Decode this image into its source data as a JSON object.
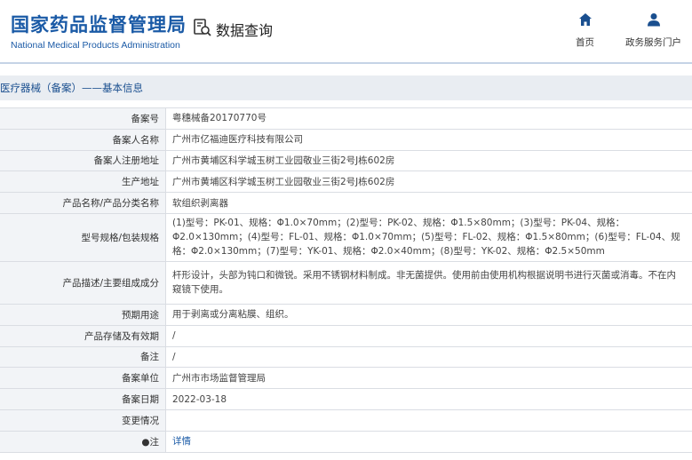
{
  "header": {
    "logo_cn": "国家药品监督管理局",
    "logo_en": "National Medical Products Administration",
    "query_label": "数据查询",
    "nav": {
      "home_label": "首页",
      "service_label": "政务服务门户"
    }
  },
  "section_title": "医疗器械（备案）——基本信息",
  "rows": [
    {
      "label": "备案号",
      "value": "粤穗械备20170770号"
    },
    {
      "label": "备案人名称",
      "value": "广州市亿福迪医疗科技有限公司"
    },
    {
      "label": "备案人注册地址",
      "value": "广州市黄埔区科学城玉树工业园敬业三街2号J栋602房"
    },
    {
      "label": "生产地址",
      "value": "广州市黄埔区科学城玉树工业园敬业三街2号J栋602房"
    },
    {
      "label": "产品名称/产品分类名称",
      "value": "软组织剥离器"
    },
    {
      "label": "型号规格/包装规格",
      "value": "(1)型号：PK-01、规格：Φ1.0×70mm；(2)型号：PK-02、规格：Φ1.5×80mm；(3)型号：PK-04、规格：Φ2.0×130mm；(4)型号：FL-01、规格：Φ1.0×70mm；(5)型号：FL-02、规格：Φ1.5×80mm；(6)型号：FL-04、规格：Φ2.0×130mm；(7)型号：YK-01、规格：Φ2.0×40mm；(8)型号：YK-02、规格：Φ2.5×50mm"
    },
    {
      "label": "产品描述/主要组成成分",
      "value": "杆形设计，头部为钝口和微锐。采用不锈钢材料制成。非无菌提供。使用前由使用机构根据说明书进行灭菌或消毒。不在内窥镜下使用。"
    },
    {
      "label": "预期用途",
      "value": "用于剥离或分离粘膜、组织。"
    },
    {
      "label": "产品存储及有效期",
      "value": "/"
    },
    {
      "label": "备注",
      "value": "/"
    },
    {
      "label": "备案单位",
      "value": "广州市市场监督管理局"
    },
    {
      "label": "备案日期",
      "value": "2022-03-18"
    },
    {
      "label": "变更情况",
      "value": ""
    },
    {
      "label": "●注",
      "value": "详情"
    }
  ],
  "icons": {
    "query": "search-document-icon",
    "home": "home-icon",
    "service": "user-icon"
  },
  "colors": {
    "brand": "#1a5aa6",
    "label_bg": "#f2f4f7",
    "titlebar_bg": "#e9edf2"
  }
}
